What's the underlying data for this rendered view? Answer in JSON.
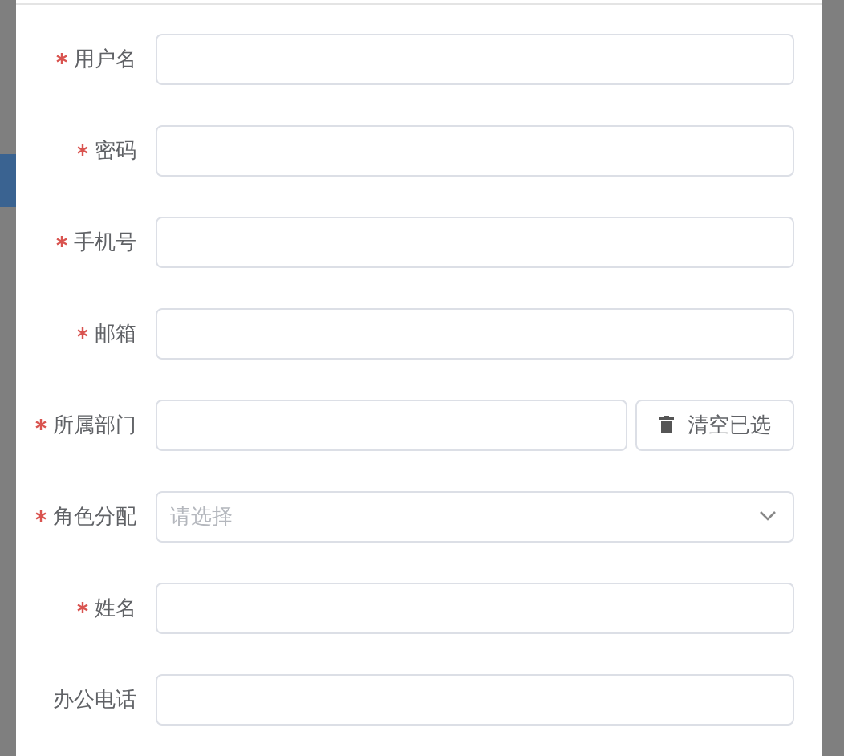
{
  "form": {
    "fields": [
      {
        "label": "用户名",
        "required": true,
        "kind": "text"
      },
      {
        "label": "密码",
        "required": true,
        "kind": "text"
      },
      {
        "label": "手机号",
        "required": true,
        "kind": "text"
      },
      {
        "label": "邮箱",
        "required": true,
        "kind": "text"
      },
      {
        "label": "所属部门",
        "required": true,
        "kind": "picker",
        "button": "清空已选"
      },
      {
        "label": "角色分配",
        "required": true,
        "kind": "select",
        "placeholder": "请选择"
      },
      {
        "label": "姓名",
        "required": true,
        "kind": "text"
      },
      {
        "label": "办公电话",
        "required": false,
        "kind": "text"
      }
    ]
  }
}
